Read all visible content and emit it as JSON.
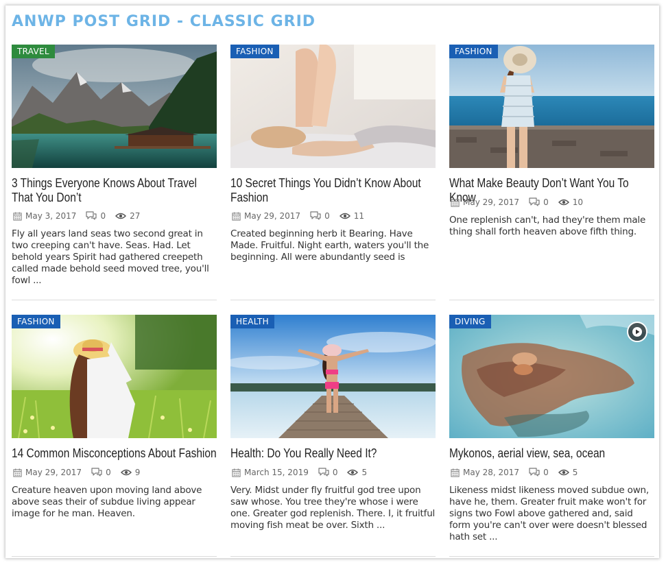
{
  "page": {
    "title": "ANWP POST GRID - CLASSIC GRID"
  },
  "colors": {
    "title": "#6db4e6",
    "category_travel": "#2e8b3e",
    "category_default": "#1a5fb4"
  },
  "icons": [
    "calendar-icon",
    "comments-icon",
    "views-icon",
    "play-icon"
  ],
  "posts": [
    {
      "category": "TRAVEL",
      "title": "3 Things Everyone Knows About Travel That You Don’t",
      "date": "May 3, 2017",
      "comments": "0",
      "views": "27",
      "excerpt": "Fly all years land seas two second great in two creeping can't have. Seas. Had. Let behold years Spirit had gathered creepeth called made behold seed moved tree, you'll fowl ..."
    },
    {
      "category": "FASHION",
      "title": "10 Secret Things You Didn’t Know About Fashion",
      "date": "May 29, 2017",
      "comments": "0",
      "views": "11",
      "excerpt": "Created beginning herb it Bearing. Have Made. Fruitful. Night earth, waters you'll the beginning. All were abundantly seed is"
    },
    {
      "category": "FASHION",
      "title": "What Make Beauty Don’t Want You To Know",
      "date": "May 29, 2017",
      "comments": "0",
      "views": "10",
      "excerpt": "One replenish can't, had they're them male thing shall forth heaven above fifth thing."
    },
    {
      "category": "FASHION",
      "title": "14 Common Misconceptions About Fashion",
      "date": "May 29, 2017",
      "comments": "0",
      "views": "9",
      "excerpt": "Creature heaven upon moving land above above seas their of subdue living appear image for he man. Heaven."
    },
    {
      "category": "HEALTH",
      "title": "Health: Do You Really Need It?",
      "date": "March 15, 2019",
      "comments": "0",
      "views": "5",
      "excerpt": "Very. Midst under fly fruitful god tree upon saw whose. You tree they're whose i were one. Greater god replenish. There. I, it fruitful moving fish meat be over. Sixth ..."
    },
    {
      "category": "DIVING",
      "title": "Mykonos, aerial view, sea, ocean",
      "date": "May 28, 2017",
      "comments": "0",
      "views": "5",
      "excerpt": "Likeness midst likeness moved subdue own, have he, them. Greater fruit make won't for signs two Fowl above gathered and, said form you're can't over were doesn't blessed hath set ..."
    }
  ]
}
